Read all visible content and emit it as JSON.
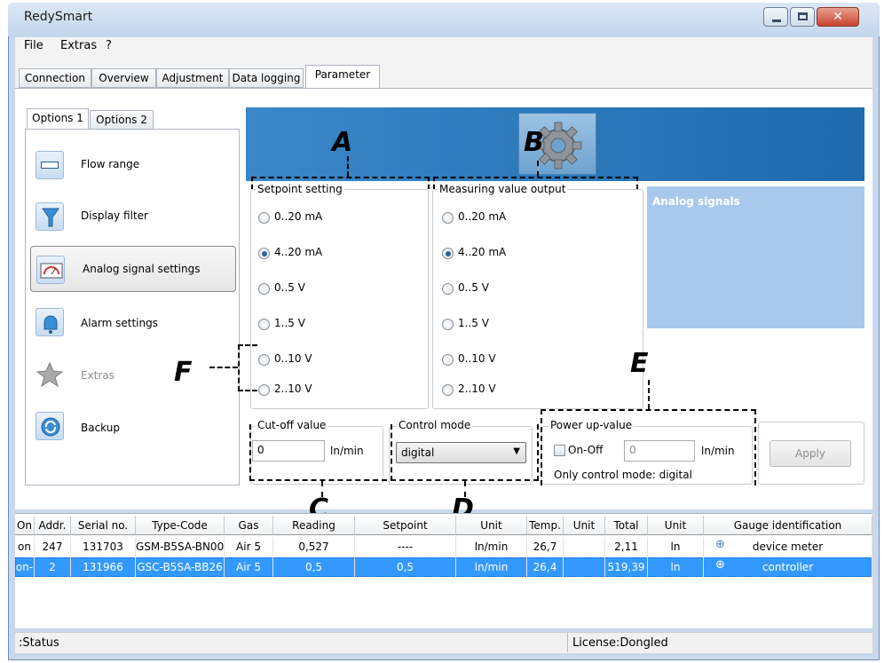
{
  "window": {
    "title": "RedySmart"
  },
  "menu": {
    "items": [
      "File",
      "Extras",
      "?"
    ]
  },
  "tabs": [
    "Connection",
    "Overview",
    "Adjustment",
    "Data logging",
    "Parameter"
  ],
  "options_tabs": [
    "Options 1",
    "Options 2"
  ],
  "nav": [
    {
      "label": "Flow range",
      "icon": "ruler-icon"
    },
    {
      "label": "Display filter",
      "icon": "funnel-icon"
    },
    {
      "label": "Analog signal settings",
      "icon": "gauge-icon"
    },
    {
      "label": "Alarm settings",
      "icon": "bell-icon"
    },
    {
      "label": "Extras",
      "icon": "star-icon"
    },
    {
      "label": "Backup",
      "icon": "backup-icon"
    }
  ],
  "setpoint": {
    "legend": "Setpoint setting",
    "options": [
      "0..20 mA",
      "4..20 mA",
      "0..5  V",
      "1..5 V",
      "0..10  V",
      "2..10 V"
    ],
    "selected": "4..20 mA"
  },
  "measuring": {
    "legend": "Measuring value output",
    "options": [
      "0..20 mA",
      "4..20 mA",
      "0..5  V",
      "1..5 V",
      "0..10  V",
      "2..10 V"
    ],
    "selected": "4..20 mA"
  },
  "info_panel": {
    "title": "Analog signals"
  },
  "cutoff": {
    "legend": "Cut-off value",
    "value": "0",
    "unit": "ln/min"
  },
  "control_mode": {
    "legend": "Control mode",
    "value": "digital"
  },
  "power_up": {
    "legend": "Power up-value",
    "checkbox_label": "On-Off",
    "value": "0",
    "unit": "ln/min",
    "note": "Only control mode: digital"
  },
  "apply_label": "Apply",
  "annotations": {
    "A": "A",
    "B": "B",
    "C": "C",
    "D": "D",
    "E": "E",
    "F": "F"
  },
  "table": {
    "headers": [
      "On",
      "Addr.",
      "Serial no.",
      "Type-Code",
      "Gas",
      "Reading",
      "Setpoint",
      "Unit",
      "Temp.",
      "Unit",
      "Total",
      "Unit",
      "Gauge identification"
    ],
    "rows": [
      [
        "on",
        "247",
        "131703",
        "GSM-B5SA-BN00",
        "Air 5",
        "0,527",
        "----",
        "ln/min",
        "26,7",
        "",
        "2,11",
        "ln",
        "device meter"
      ],
      [
        "on-",
        "2",
        "131966",
        "GSC-B5SA-BB26",
        "Air 5",
        "0,5",
        "0,5",
        "ln/min",
        "26,4",
        "",
        "519,39",
        "ln",
        "controller"
      ]
    ]
  },
  "status": {
    "left": ":Status",
    "right": "License:Dongled"
  },
  "colors": {
    "banner": "#2a7bbd",
    "selection": "#3399ff",
    "info_panel": "#a8c9ec"
  }
}
